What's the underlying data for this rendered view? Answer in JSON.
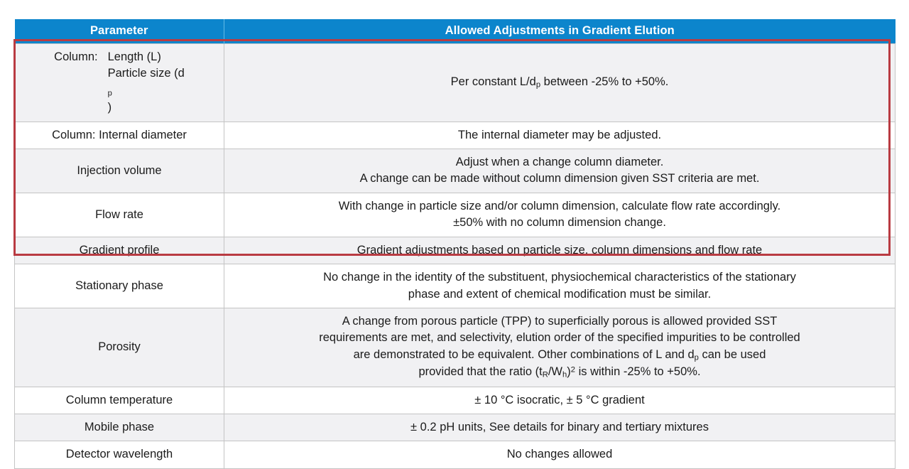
{
  "table": {
    "headers": {
      "parameter": "Parameter",
      "allowed": "Allowed Adjustments in Gradient Elution"
    },
    "colors": {
      "header_blue": "#0c85cc",
      "highlight_red": "#b93b42",
      "shade_gray": "#f1f1f3",
      "grid_gray": "#c4c4c4"
    },
    "rows": [
      {
        "id": "column-length-particle",
        "parameter_label": "Column:",
        "parameter_line1": "Length (L)",
        "parameter_line2_pre": "Particle size (d",
        "parameter_line2_sub": "p",
        "parameter_line2_post": ")",
        "value_pre": "Per constant L/d",
        "value_sub": "p",
        "value_post": " between -25% to +50%."
      },
      {
        "id": "column-internal-diameter",
        "parameter": "Column: Internal diameter",
        "value": "The internal diameter may be adjusted."
      },
      {
        "id": "injection-volume",
        "parameter": "Injection volume",
        "value_line1": "Adjust when a change column diameter.",
        "value_line2": "A change can be made without column dimension given SST criteria are met."
      },
      {
        "id": "flow-rate",
        "parameter": "Flow rate",
        "value_line1": "With change in particle size and/or column dimension, calculate flow rate accordingly.",
        "value_line2": "±50% with no column dimension change."
      },
      {
        "id": "gradient-profile",
        "parameter": "Gradient profile",
        "value": "Gradient adjustments based on particle size, column dimensions and flow rate"
      },
      {
        "id": "stationary-phase",
        "parameter": "Stationary phase",
        "value_line1": "No change in the identity of the substituent, physiochemical characteristics of the stationary",
        "value_line2": "phase and extent of chemical modification must be similar."
      },
      {
        "id": "porosity",
        "parameter": "Porosity",
        "value_line1": "A change from porous particle (TPP) to superficially porous is allowed provided SST",
        "value_line2": "requirements are met, and selectivity, elution order of the specified impurities to be controlled",
        "value_line3_pre": "are demonstrated to be equivalent. Other combinations of L and d",
        "value_line3_sub": "p",
        "value_line3_post": " can be used",
        "value_line4_pre": "provided that the ratio (t",
        "value_line4_sub1": "R",
        "value_line4_mid": "/W",
        "value_line4_sub2": "h",
        "value_line4_close": ")",
        "value_line4_sup": "2",
        "value_line4_post": " is within -25% to +50%."
      },
      {
        "id": "column-temperature",
        "parameter": "Column temperature",
        "value": "± 10 °C isocratic, ± 5 °C gradient"
      },
      {
        "id": "mobile-phase",
        "parameter": "Mobile phase",
        "value": "± 0.2 pH units, See details for binary and tertiary mixtures"
      },
      {
        "id": "detector-wavelength",
        "parameter": "Detector wavelength",
        "value": "No changes allowed"
      }
    ]
  }
}
